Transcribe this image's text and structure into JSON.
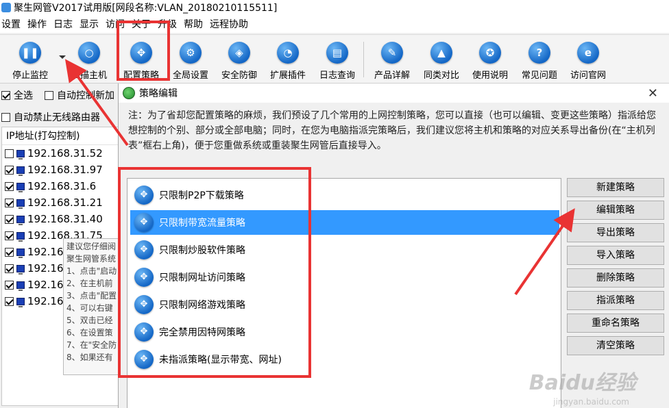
{
  "window": {
    "title": "聚生网管V2017试用版[网段名称:VLAN_20180210115511]"
  },
  "menu": [
    "设置",
    "操作",
    "日志",
    "显示",
    "访问",
    "关于",
    "升级",
    "帮助",
    "远程协助"
  ],
  "toolbar": [
    {
      "label": "停止监控",
      "icon": "pause-icon"
    },
    {
      "label": "扫描主机",
      "icon": "search-icon"
    },
    {
      "label": "配置策略",
      "icon": "strategy-icon"
    },
    {
      "label": "全局设置",
      "icon": "gear-icon"
    },
    {
      "label": "安全防御",
      "icon": "shield-icon"
    },
    {
      "label": "扩展插件",
      "icon": "plugin-icon"
    },
    {
      "label": "日志查询",
      "icon": "log-icon"
    },
    {
      "label": "产品详解",
      "icon": "edit-icon"
    },
    {
      "label": "同类对比",
      "icon": "graduation-icon"
    },
    {
      "label": "使用说明",
      "icon": "badge-icon"
    },
    {
      "label": "常见问题",
      "icon": "question-icon"
    },
    {
      "label": "访问官网",
      "icon": "browser-icon"
    }
  ],
  "left": {
    "select_all": "全选",
    "auto_control_new": "自动控制新加",
    "auto_block_wireless": "自动禁止无线路由器",
    "ip_header": "IP地址(打勾控制)",
    "ips": [
      {
        "ip": "192.168.31.52",
        "checked": false
      },
      {
        "ip": "192.168.31.97",
        "checked": true
      },
      {
        "ip": "192.168.31.6",
        "checked": true
      },
      {
        "ip": "192.168.31.21",
        "checked": true
      },
      {
        "ip": "192.168.31.40",
        "checked": true
      },
      {
        "ip": "192.168.31.75",
        "checked": true
      },
      {
        "ip": "192.16",
        "checked": true
      },
      {
        "ip": "192.16",
        "checked": true
      },
      {
        "ip": "192.16",
        "checked": true
      },
      {
        "ip": "192.16",
        "checked": true
      }
    ],
    "tip_lines": [
      "建议您仔细阅",
      "聚生网管系统",
      "1、点击\"启动",
      "2、在主机前",
      "3、点击\"配置",
      "4、可以右键",
      "5、双击已经",
      "6、在设置策",
      "7、在\"安全防",
      "8、如果还有"
    ]
  },
  "dialog": {
    "title": "策略编辑",
    "close": "✕",
    "note": "注：为了省却您配置策略的麻烦，我们预设了几个常用的上网控制策略，您可以直接（也可以编辑、变更这些策略）指派给您想控制的个别、部分或全部电脑；同时，在您为电脑指派完策略后，我们建议您将主机和策略的对应关系导出备份(在“主机列表”框右上角)，便于您重做系统或重装聚生网管后直接导入。",
    "policies": [
      "只限制P2P下载策略",
      "只限制带宽流量策略",
      "只限制炒股软件策略",
      "只限制网址访问策略",
      "只限制网络游戏策略",
      "完全禁用因特网策略",
      "未指派策略(显示带宽、网址)"
    ],
    "selected_index": 1,
    "buttons": [
      "新建策略",
      "编辑策略",
      "导出策略",
      "导入策略",
      "删除策略",
      "指派策略",
      "重命名策略",
      "清空策略"
    ]
  },
  "watermark": {
    "main": "Baidu经验",
    "sub": "jingyan.baidu.com"
  },
  "colors": {
    "selection": "#3399ff",
    "annotation": "#e93333",
    "icon_blue": "#1467c6"
  }
}
